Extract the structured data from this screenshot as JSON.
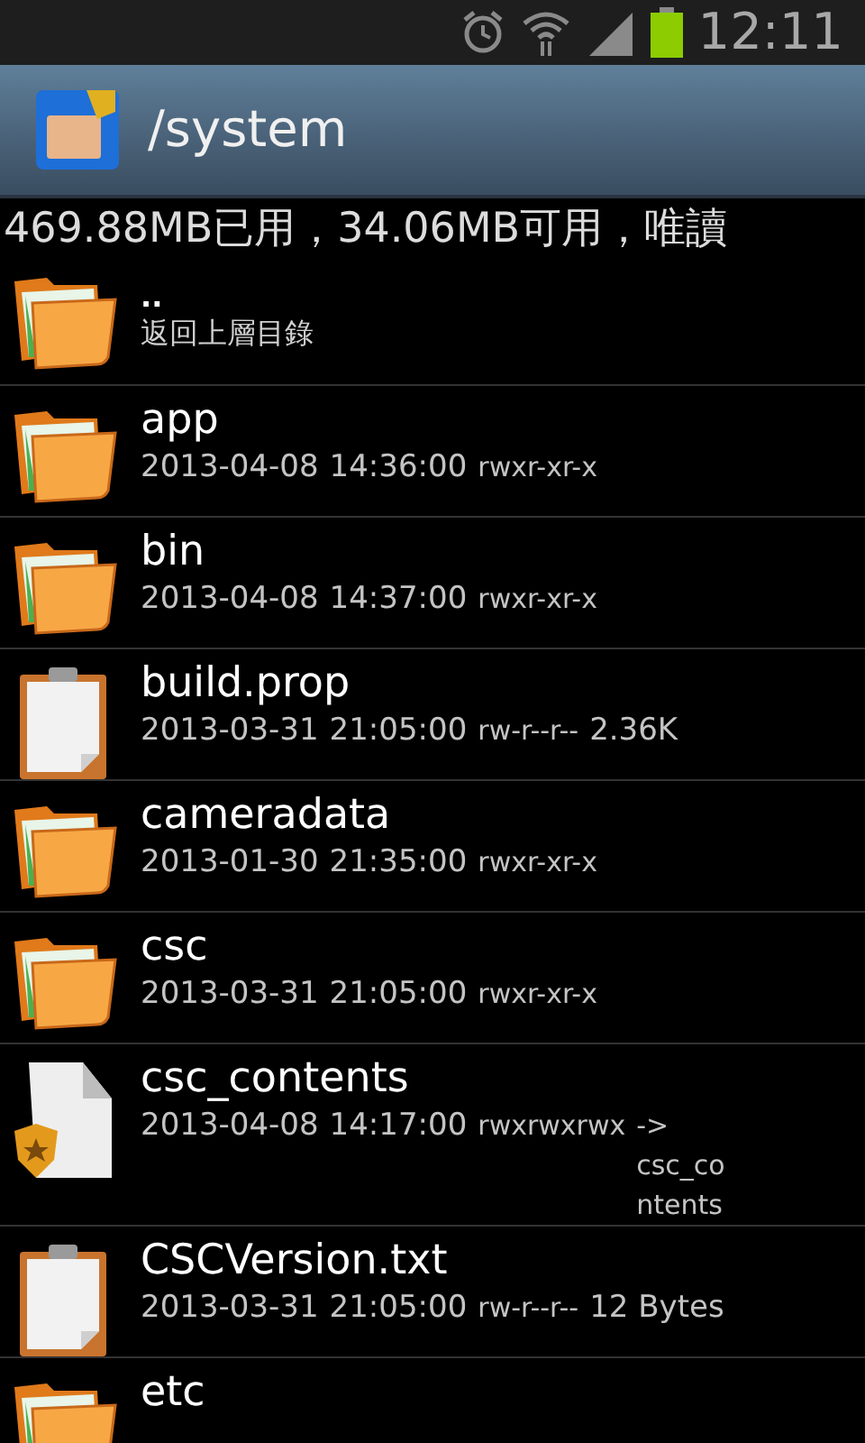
{
  "status_bar": {
    "time": "12:11"
  },
  "title_bar": {
    "path": "/system"
  },
  "storage_info": "469.88MB已用，34.06MB可用，唯讀",
  "parent_row": {
    "name": "..",
    "label": "返回上層目錄"
  },
  "files": [
    {
      "kind": "folder",
      "name": "app",
      "date": "2013-04-08",
      "time": "14:36:00",
      "perms": "rwxr-xr-x"
    },
    {
      "kind": "folder",
      "name": "bin",
      "date": "2013-04-08",
      "time": "14:37:00",
      "perms": "rwxr-xr-x"
    },
    {
      "kind": "text",
      "name": "build.prop",
      "date": "2013-03-31",
      "time": "21:05:00",
      "perms": "rw-r--r--",
      "size": "2.36K"
    },
    {
      "kind": "folder",
      "name": "cameradata",
      "date": "2013-01-30",
      "time": "21:35:00",
      "perms": "rwxr-xr-x"
    },
    {
      "kind": "folder",
      "name": "csc",
      "date": "2013-03-31",
      "time": "21:05:00",
      "perms": "rwxr-xr-x"
    },
    {
      "kind": "link",
      "name": "csc_contents",
      "date": "2013-04-08",
      "time": "14:17:00",
      "perms": "rwxrwxrwx",
      "link_arrow": "->",
      "link_target": "csc_contents"
    },
    {
      "kind": "text",
      "name": "CSCVersion.txt",
      "date": "2013-03-31",
      "time": "21:05:00",
      "perms": "rw-r--r--",
      "size": "12 Bytes"
    },
    {
      "kind": "folder",
      "name": "etc"
    }
  ]
}
